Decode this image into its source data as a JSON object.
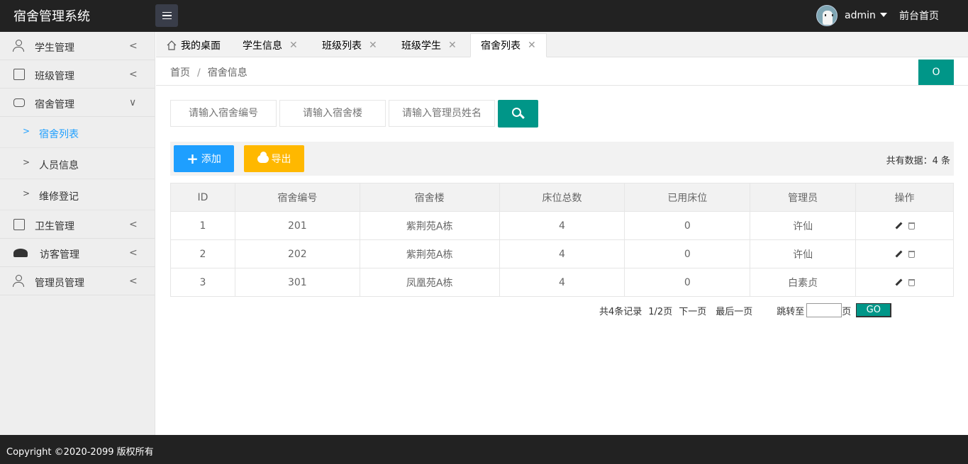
{
  "app": {
    "title": "宿舍管理系统"
  },
  "header": {
    "user_name": "admin",
    "front_link": "前台首页"
  },
  "sidebar": {
    "items": [
      {
        "label": "学生管理",
        "arrow": "<"
      },
      {
        "label": "班级管理",
        "arrow": "<"
      },
      {
        "label": "宿舍管理",
        "arrow": "∨"
      },
      {
        "label": "卫生管理",
        "arrow": "<"
      },
      {
        "label": "访客管理",
        "arrow": "<"
      },
      {
        "label": "管理员管理",
        "arrow": "<"
      }
    ],
    "sub_items": [
      {
        "label": "宿舍列表",
        "arrow": ">"
      },
      {
        "label": "人员信息",
        "arrow": ">"
      },
      {
        "label": "维修登记",
        "arrow": ">"
      }
    ]
  },
  "tabs": [
    {
      "label": "我的桌面"
    },
    {
      "label": "学生信息"
    },
    {
      "label": "班级列表"
    },
    {
      "label": "班级学生"
    },
    {
      "label": "宿舍列表"
    }
  ],
  "tab_close": "✕",
  "breadcrumb": {
    "home": "首页",
    "separator": "/",
    "current": "宿舍信息"
  },
  "refresh_glyph": "O",
  "search": {
    "dorm_no_placeholder": "请输入宿舍编号",
    "building_placeholder": "请输入宿舍楼",
    "manager_placeholder": "请输入管理员姓名"
  },
  "toolbar": {
    "add_label": "添加",
    "add_plus": "+",
    "export_label": "导出",
    "total_text": "共有数据：4 条"
  },
  "table": {
    "headers": [
      "ID",
      "宿舍编号",
      "宿舍楼",
      "床位总数",
      "已用床位",
      "管理员",
      "操作"
    ],
    "rows": [
      [
        "1",
        "201",
        "紫荆苑A栋",
        "4",
        "0",
        "许仙"
      ],
      [
        "2",
        "202",
        "紫荆苑A栋",
        "4",
        "0",
        "许仙"
      ],
      [
        "3",
        "301",
        "凤凰苑A栋",
        "4",
        "0",
        "白素贞"
      ]
    ]
  },
  "pager": {
    "records": "共4条记录",
    "page": "1/2页",
    "next": "下一页",
    "last": "最后一页",
    "jump_to": "跳转至",
    "page_unit": "页",
    "go": "GO"
  },
  "footer": {
    "copyright": "Copyright ©2020-2099 版权所有"
  },
  "colors": {
    "primary": "#009688",
    "blue": "#1e9fff",
    "warm": "#ffb800",
    "header_bg": "#222222"
  }
}
